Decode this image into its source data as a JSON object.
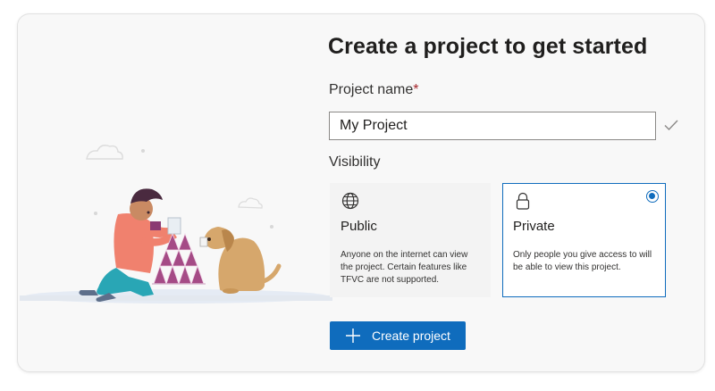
{
  "page": {
    "title": "Create a project to get started"
  },
  "form": {
    "project_name_label": "Project name",
    "required_marker": "*",
    "project_name_value": "My Project",
    "visibility_label": "Visibility"
  },
  "visibility": {
    "public": {
      "title": "Public",
      "description": "Anyone on the internet can view the project. Certain features like TFVC are not supported.",
      "icon": "globe-icon"
    },
    "private": {
      "title": "Private",
      "description": "Only people you give access to will be able to view this project.",
      "icon": "lock-icon",
      "selected": true
    }
  },
  "actions": {
    "create_label": "Create project",
    "create_icon": "plus-icon"
  },
  "colors": {
    "accent": "#0f6cbd",
    "required": "#a4262c",
    "card_background": "#f8f8f8"
  }
}
